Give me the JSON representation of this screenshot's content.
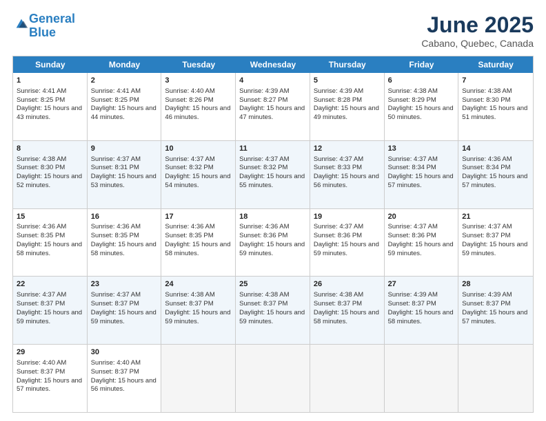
{
  "header": {
    "logo_line1": "General",
    "logo_line2": "Blue",
    "title": "June 2025",
    "subtitle": "Cabano, Quebec, Canada"
  },
  "days_of_week": [
    "Sunday",
    "Monday",
    "Tuesday",
    "Wednesday",
    "Thursday",
    "Friday",
    "Saturday"
  ],
  "weeks": [
    [
      {
        "day": "1",
        "sunrise": "Sunrise: 4:41 AM",
        "sunset": "Sunset: 8:25 PM",
        "daylight": "Daylight: 15 hours and 43 minutes."
      },
      {
        "day": "2",
        "sunrise": "Sunrise: 4:41 AM",
        "sunset": "Sunset: 8:25 PM",
        "daylight": "Daylight: 15 hours and 44 minutes."
      },
      {
        "day": "3",
        "sunrise": "Sunrise: 4:40 AM",
        "sunset": "Sunset: 8:26 PM",
        "daylight": "Daylight: 15 hours and 46 minutes."
      },
      {
        "day": "4",
        "sunrise": "Sunrise: 4:39 AM",
        "sunset": "Sunset: 8:27 PM",
        "daylight": "Daylight: 15 hours and 47 minutes."
      },
      {
        "day": "5",
        "sunrise": "Sunrise: 4:39 AM",
        "sunset": "Sunset: 8:28 PM",
        "daylight": "Daylight: 15 hours and 49 minutes."
      },
      {
        "day": "6",
        "sunrise": "Sunrise: 4:38 AM",
        "sunset": "Sunset: 8:29 PM",
        "daylight": "Daylight: 15 hours and 50 minutes."
      },
      {
        "day": "7",
        "sunrise": "Sunrise: 4:38 AM",
        "sunset": "Sunset: 8:30 PM",
        "daylight": "Daylight: 15 hours and 51 minutes."
      }
    ],
    [
      {
        "day": "8",
        "sunrise": "Sunrise: 4:38 AM",
        "sunset": "Sunset: 8:30 PM",
        "daylight": "Daylight: 15 hours and 52 minutes."
      },
      {
        "day": "9",
        "sunrise": "Sunrise: 4:37 AM",
        "sunset": "Sunset: 8:31 PM",
        "daylight": "Daylight: 15 hours and 53 minutes."
      },
      {
        "day": "10",
        "sunrise": "Sunrise: 4:37 AM",
        "sunset": "Sunset: 8:32 PM",
        "daylight": "Daylight: 15 hours and 54 minutes."
      },
      {
        "day": "11",
        "sunrise": "Sunrise: 4:37 AM",
        "sunset": "Sunset: 8:32 PM",
        "daylight": "Daylight: 15 hours and 55 minutes."
      },
      {
        "day": "12",
        "sunrise": "Sunrise: 4:37 AM",
        "sunset": "Sunset: 8:33 PM",
        "daylight": "Daylight: 15 hours and 56 minutes."
      },
      {
        "day": "13",
        "sunrise": "Sunrise: 4:37 AM",
        "sunset": "Sunset: 8:34 PM",
        "daylight": "Daylight: 15 hours and 57 minutes."
      },
      {
        "day": "14",
        "sunrise": "Sunrise: 4:36 AM",
        "sunset": "Sunset: 8:34 PM",
        "daylight": "Daylight: 15 hours and 57 minutes."
      }
    ],
    [
      {
        "day": "15",
        "sunrise": "Sunrise: 4:36 AM",
        "sunset": "Sunset: 8:35 PM",
        "daylight": "Daylight: 15 hours and 58 minutes."
      },
      {
        "day": "16",
        "sunrise": "Sunrise: 4:36 AM",
        "sunset": "Sunset: 8:35 PM",
        "daylight": "Daylight: 15 hours and 58 minutes."
      },
      {
        "day": "17",
        "sunrise": "Sunrise: 4:36 AM",
        "sunset": "Sunset: 8:35 PM",
        "daylight": "Daylight: 15 hours and 58 minutes."
      },
      {
        "day": "18",
        "sunrise": "Sunrise: 4:36 AM",
        "sunset": "Sunset: 8:36 PM",
        "daylight": "Daylight: 15 hours and 59 minutes."
      },
      {
        "day": "19",
        "sunrise": "Sunrise: 4:37 AM",
        "sunset": "Sunset: 8:36 PM",
        "daylight": "Daylight: 15 hours and 59 minutes."
      },
      {
        "day": "20",
        "sunrise": "Sunrise: 4:37 AM",
        "sunset": "Sunset: 8:36 PM",
        "daylight": "Daylight: 15 hours and 59 minutes."
      },
      {
        "day": "21",
        "sunrise": "Sunrise: 4:37 AM",
        "sunset": "Sunset: 8:37 PM",
        "daylight": "Daylight: 15 hours and 59 minutes."
      }
    ],
    [
      {
        "day": "22",
        "sunrise": "Sunrise: 4:37 AM",
        "sunset": "Sunset: 8:37 PM",
        "daylight": "Daylight: 15 hours and 59 minutes."
      },
      {
        "day": "23",
        "sunrise": "Sunrise: 4:37 AM",
        "sunset": "Sunset: 8:37 PM",
        "daylight": "Daylight: 15 hours and 59 minutes."
      },
      {
        "day": "24",
        "sunrise": "Sunrise: 4:38 AM",
        "sunset": "Sunset: 8:37 PM",
        "daylight": "Daylight: 15 hours and 59 minutes."
      },
      {
        "day": "25",
        "sunrise": "Sunrise: 4:38 AM",
        "sunset": "Sunset: 8:37 PM",
        "daylight": "Daylight: 15 hours and 59 minutes."
      },
      {
        "day": "26",
        "sunrise": "Sunrise: 4:38 AM",
        "sunset": "Sunset: 8:37 PM",
        "daylight": "Daylight: 15 hours and 58 minutes."
      },
      {
        "day": "27",
        "sunrise": "Sunrise: 4:39 AM",
        "sunset": "Sunset: 8:37 PM",
        "daylight": "Daylight: 15 hours and 58 minutes."
      },
      {
        "day": "28",
        "sunrise": "Sunrise: 4:39 AM",
        "sunset": "Sunset: 8:37 PM",
        "daylight": "Daylight: 15 hours and 57 minutes."
      }
    ],
    [
      {
        "day": "29",
        "sunrise": "Sunrise: 4:40 AM",
        "sunset": "Sunset: 8:37 PM",
        "daylight": "Daylight: 15 hours and 57 minutes."
      },
      {
        "day": "30",
        "sunrise": "Sunrise: 4:40 AM",
        "sunset": "Sunset: 8:37 PM",
        "daylight": "Daylight: 15 hours and 56 minutes."
      },
      {
        "day": "",
        "sunrise": "",
        "sunset": "",
        "daylight": ""
      },
      {
        "day": "",
        "sunrise": "",
        "sunset": "",
        "daylight": ""
      },
      {
        "day": "",
        "sunrise": "",
        "sunset": "",
        "daylight": ""
      },
      {
        "day": "",
        "sunrise": "",
        "sunset": "",
        "daylight": ""
      },
      {
        "day": "",
        "sunrise": "",
        "sunset": "",
        "daylight": ""
      }
    ]
  ]
}
